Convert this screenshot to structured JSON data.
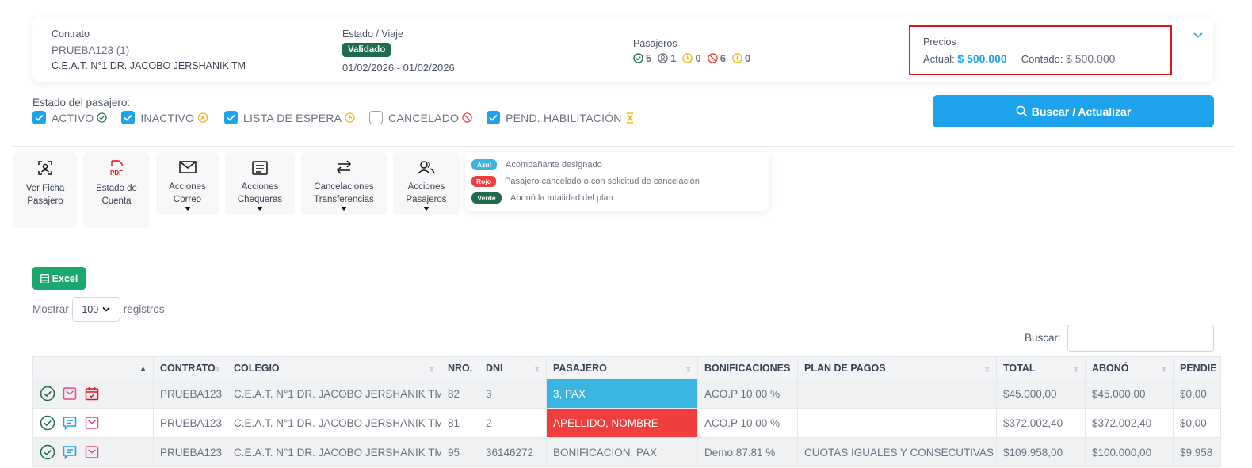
{
  "header": {
    "contract_label": "Contrato",
    "contract_id": "PRUEBA123 (1)",
    "school": "C.E.A.T. N°1 DR. JACOBO JERSHANIK TM",
    "status_label": "Estado / Viaje",
    "status_badge": "Validado",
    "dates": "01/02/2026 - 01/02/2026",
    "passengers_label": "Pasajeros",
    "counts": {
      "active": "5",
      "inactive": "1",
      "waiting": "0",
      "cancelled": "6",
      "pending": "0"
    },
    "prices_label": "Precios",
    "actual_label": "Actual:",
    "actual_value": "$ 500.000",
    "cash_label": "Contado:",
    "cash_value": "$ 500.000"
  },
  "filters": {
    "title": "Estado del pasajero:",
    "items": [
      {
        "label": "ACTIVO",
        "checked": true
      },
      {
        "label": "INACTIVO",
        "checked": true
      },
      {
        "label": "LISTA DE ESPERA",
        "checked": true
      },
      {
        "label": "CANCELADO",
        "checked": false
      },
      {
        "label": "PEND. HABILITACIÓN",
        "checked": true
      }
    ],
    "search_button": "Buscar / Actualizar"
  },
  "actions": {
    "view_file": [
      "Ver Ficha",
      "Pasajero"
    ],
    "account": [
      "Estado de",
      "Cuenta"
    ],
    "mail": [
      "Acciones",
      "Correo"
    ],
    "checks": [
      "Acciones",
      "Chequeras"
    ],
    "cancellations": [
      "Cancelaciones",
      "Transferencias"
    ],
    "passengers": [
      "Acciones",
      "Pasajeros"
    ]
  },
  "legend": [
    {
      "tag": "Azul",
      "text": "Acompañante designado",
      "color": "#3ab4e0"
    },
    {
      "tag": "Rojo",
      "text": "Pasajero cancelado o con solicitud de cancelación",
      "color": "#f03e3e"
    },
    {
      "tag": "Verde",
      "text": "Abonó la totalidad del plan",
      "color": "#1e6b4d"
    }
  ],
  "export": {
    "excel_label": "Excel"
  },
  "paging": {
    "show_label": "Mostrar",
    "page_size": "100",
    "records_label": "registros"
  },
  "search": {
    "label": "Buscar:"
  },
  "table": {
    "columns": [
      "",
      "CONTRATO",
      "COLEGIO",
      "NRO.",
      "DNI",
      "PASAJERO",
      "BONIFICACIONES",
      "PLAN DE PAGOS",
      "TOTAL",
      "ABONÓ",
      "PENDIE"
    ],
    "rows": [
      {
        "contrato": "PRUEBA123",
        "colegio": "C.E.A.T. N°1 DR. JACOBO JERSHANIK TM",
        "nro": "82",
        "dni": "3",
        "pasajero": "3, PAX",
        "bonificaciones": "ACO.P 10.00 %",
        "plan": "",
        "total": "$45.000,00",
        "abono": "$45.000,00",
        "pendiente": "$0,00"
      },
      {
        "contrato": "PRUEBA123",
        "colegio": "C.E.A.T. N°1 DR. JACOBO JERSHANIK TM",
        "nro": "81",
        "dni": "2",
        "pasajero": "APELLIDO, NOMBRE",
        "bonificaciones": "ACO.P 10.00 %",
        "plan": "",
        "total": "$372.002,40",
        "abono": "$372.002,40",
        "pendiente": "$0,00"
      },
      {
        "contrato": "PRUEBA123",
        "colegio": "C.E.A.T. N°1 DR. JACOBO JERSHANIK TM",
        "nro": "95",
        "dni": "36146272",
        "pasajero": "BONIFICACION, PAX",
        "bonificaciones": "Demo 87.81 %",
        "plan": "CUOTAS IGUALES Y CONSECUTIVAS",
        "total": "$109.958,00",
        "abono": "$100.000,00",
        "pendiente": "$9.958"
      }
    ]
  },
  "colors": {
    "accent": "#1ca3ec",
    "valid_badge": "#1e6b4d",
    "excel": "#1aa86f",
    "highlight_border": "#e4111b"
  }
}
